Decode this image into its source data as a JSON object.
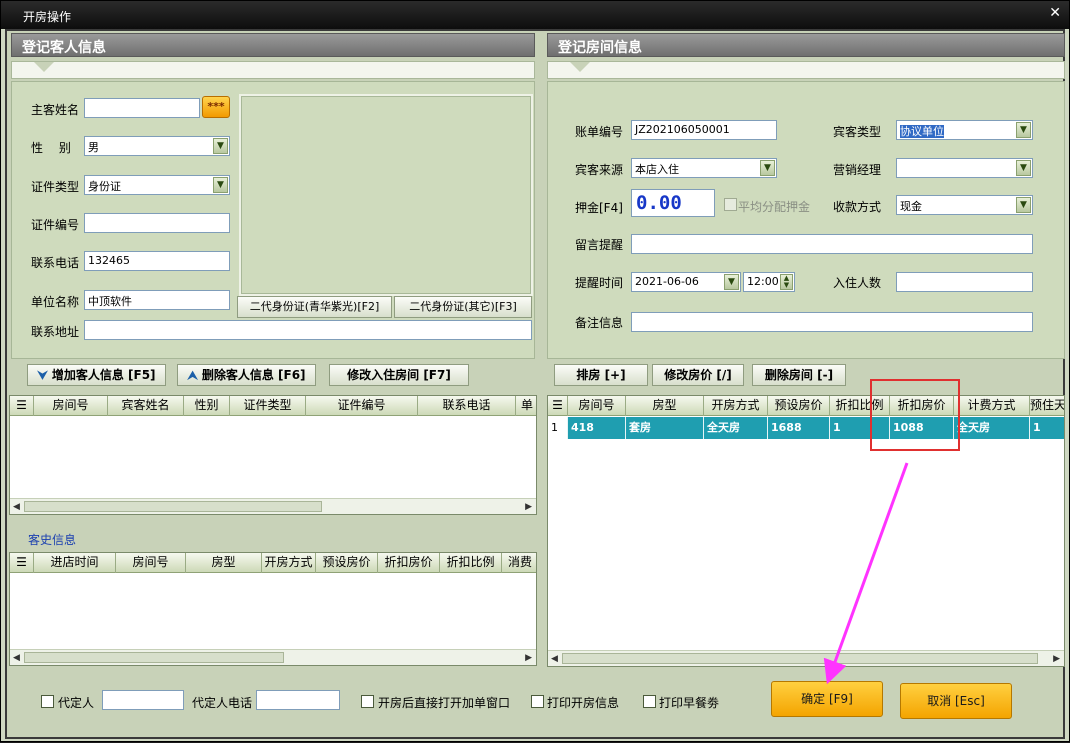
{
  "window": {
    "title": "开房操作",
    "close_label": "✕"
  },
  "guest_panel": {
    "header": "登记客人信息",
    "labels": {
      "name": "主客姓名",
      "gender": "性　 别",
      "id_type": "证件类型",
      "id_no": "证件编号",
      "phone": "联系电话",
      "company": "单位名称",
      "address": "联系地址"
    },
    "values": {
      "name": "",
      "gender": "男",
      "id_type": "身份证",
      "id_no": "",
      "phone": "132465",
      "company": "中顶软件",
      "address": ""
    },
    "star_button": "***",
    "id_reader_1": "二代身份证(青华紫光)[F2]",
    "id_reader_2": "二代身份证(其它)[F3]"
  },
  "guest_buttons": {
    "add": "增加客人信息 [F5]",
    "delete": "删除客人信息 [F6]",
    "modify": "修改入住房间 [F7]"
  },
  "guest_grid": {
    "columns": [
      "房间号",
      "宾客姓名",
      "性别",
      "证件类型",
      "证件编号",
      "联系电话",
      "单"
    ]
  },
  "history": {
    "title": "客史信息",
    "columns": [
      "进店时间",
      "房间号",
      "房型",
      "开房方式",
      "预设房价",
      "折扣房价",
      "折扣比例",
      "消费"
    ]
  },
  "room_panel": {
    "header": "登记房间信息",
    "labels": {
      "bill_no": "账单编号",
      "guest_type": "宾客类型",
      "source": "宾客来源",
      "sales": "营销经理",
      "deposit": "押金[F4]",
      "split": "平均分配押金",
      "payment": "收款方式",
      "message": "留言提醒",
      "remind_time": "提醒时间",
      "guest_count": "入住人数",
      "remark": "备注信息"
    },
    "values": {
      "bill_no": "JZ202106050001",
      "guest_type": "协议单位",
      "source": "本店入住",
      "sales": "",
      "deposit": "0.00",
      "payment": "现金",
      "message": "",
      "remind_date": "2021-06-06",
      "remind_time": "12:00",
      "guest_count": "",
      "remark": ""
    }
  },
  "room_buttons": {
    "arrange": "排房 [+]",
    "modify_price": "修改房价 [/]",
    "delete": "删除房间 [-]"
  },
  "room_grid": {
    "columns": [
      "房间号",
      "房型",
      "开房方式",
      "预设房价",
      "折扣比例",
      "折扣房价",
      "计费方式",
      "预住天"
    ],
    "rows": [
      {
        "idx": "1",
        "cells": [
          "418",
          "套房",
          "全天房",
          "1688",
          "1",
          "1088",
          "全天房",
          "1"
        ]
      }
    ]
  },
  "footer": {
    "agent": "代定人",
    "agent_phone": "代定人电话",
    "open_add": "开房后直接打开加单窗口",
    "print_open": "打印开房信息",
    "print_breakfast": "打印早餐劵",
    "ok": "确定 [F9]",
    "cancel": "取消 [Esc]"
  },
  "colors": {
    "accent": "#f4a400",
    "row_selected": "#1f9eb0",
    "annotation": "#e0302f",
    "arrow": "#ff33ff"
  }
}
